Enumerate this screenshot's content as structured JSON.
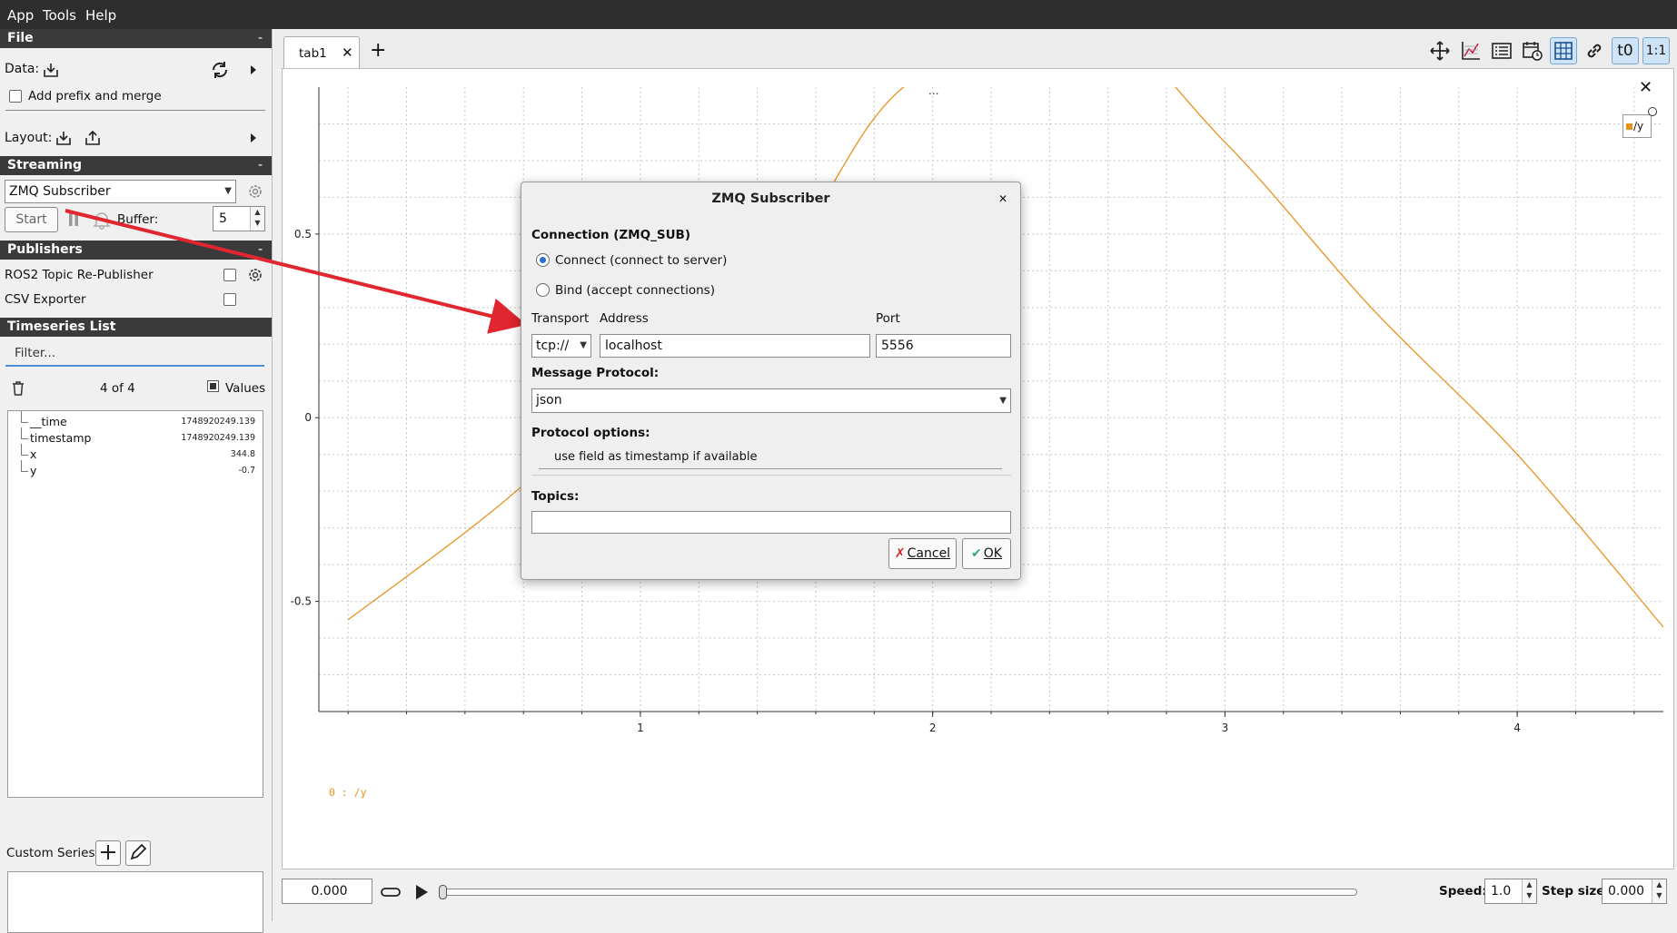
{
  "menubar": {
    "items": [
      "App",
      "Tools",
      "Help"
    ]
  },
  "left": {
    "file_section": "File",
    "data_label": "Data:",
    "add_prefix_label": "Add prefix and merge",
    "layout_label": "Layout:",
    "streaming_section": "Streaming",
    "streaming_combo": "ZMQ Subscriber",
    "start_label": "Start",
    "buffer_label": "Buffer:",
    "buffer_value": "5",
    "publishers_section": "Publishers",
    "publishers": [
      "ROS2 Topic Re-Publisher",
      "CSV Exporter"
    ],
    "timeseries_section": "Timeseries List",
    "filter_placeholder": "Filter...",
    "count": "4 of 4",
    "values_label": "Values",
    "tree": [
      {
        "name": "__time",
        "value": "1748920249.139"
      },
      {
        "name": "timestamp",
        "value": "1748920249.139"
      },
      {
        "name": "x",
        "value": "344.8"
      },
      {
        "name": "y",
        "value": "-0.7"
      }
    ],
    "custom_series_label": "Custom Series:"
  },
  "tabs": {
    "tab1": "tab1",
    "add": "+"
  },
  "toolbar_icons": [
    "move-icon",
    "chart-icon",
    "list-icon",
    "calendar-icon",
    "grid-icon",
    "link-icon",
    "t0-icon",
    "one-to-one-icon"
  ],
  "toolbar_text": {
    "t0": "t0",
    "ratio": "1:1"
  },
  "plot": {
    "ellipsis": "...",
    "legend": "/y",
    "series_label": "0 : /y",
    "y_ticks": [
      "0.5",
      "0",
      "-0.5"
    ],
    "x_ticks": [
      "1",
      "2",
      "3",
      "4"
    ],
    "line_color": "#e8921e"
  },
  "chart_data": {
    "type": "line",
    "series": [
      {
        "name": "/y",
        "x": [
          0.0,
          0.5,
          1.0,
          1.5,
          1.9,
          2.5,
          3.0,
          3.5,
          4.0,
          4.5
        ],
        "y": [
          -0.55,
          -0.25,
          0.1,
          0.45,
          0.9,
          1.1,
          0.75,
          0.3,
          -0.1,
          -0.57
        ]
      }
    ],
    "title": "",
    "xlabel": "",
    "ylabel": "",
    "xlim": [
      -0.1,
      4.5
    ],
    "ylim": [
      -0.8,
      0.9
    ],
    "grid": true,
    "legend": "top-right"
  },
  "bottom": {
    "time_value": "0.000",
    "speed_label": "Speed:",
    "speed_value": "1.0",
    "step_label": "Step size:",
    "step_value": "0.000"
  },
  "dialog": {
    "title": "ZMQ Subscriber",
    "connection_label": "Connection (ZMQ_SUB)",
    "connect_option": "Connect (connect to server)",
    "bind_option": "Bind (accept connections)",
    "transport_label": "Transport",
    "address_label": "Address",
    "port_label": "Port",
    "transport_value": "tcp://",
    "address_value": "localhost",
    "port_value": "5556",
    "protocol_label": "Message Protocol:",
    "protocol_value": "json",
    "options_label": "Protocol options:",
    "option_timestamp": "use field as timestamp if available",
    "topics_label": "Topics:",
    "topics_value": "",
    "cancel_label": "Cancel",
    "ok_label": "OK"
  },
  "annotation": {
    "arrow_color": "#e0262e"
  }
}
